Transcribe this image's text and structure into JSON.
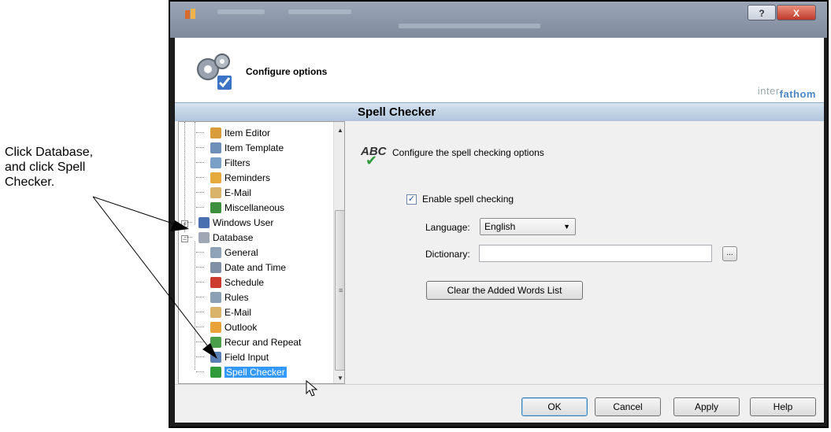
{
  "annotation": {
    "lines": [
      "Click Database,",
      "and click Spell",
      "Checker."
    ]
  },
  "window": {
    "help_button": "?",
    "close_button": "X"
  },
  "header": {
    "title": "Configure options",
    "brand_prefix": "inter",
    "brand_suffix": "fathom"
  },
  "section": {
    "title": "Spell Checker"
  },
  "tree": {
    "items": [
      {
        "label": "Item Editor",
        "icon": "item-editor-icon",
        "color": "#d89c3a"
      },
      {
        "label": "Item Template",
        "icon": "item-template-icon",
        "color": "#6e8fb8"
      },
      {
        "label": "Filters",
        "icon": "filters-icon",
        "color": "#7aa0c8"
      },
      {
        "label": "Reminders",
        "icon": "reminders-icon",
        "color": "#e6a93b"
      },
      {
        "label": "E-Mail",
        "icon": "email-icon",
        "color": "#d9b36a"
      },
      {
        "label": "Miscellaneous",
        "icon": "miscellaneous-icon",
        "color": "#3c8f3c"
      },
      {
        "label": "Windows User",
        "icon": "windows-user-icon",
        "color": "#4a6fb0"
      },
      {
        "label": "Database",
        "icon": "database-icon",
        "color": "#9ea7b3"
      },
      {
        "label": "General",
        "icon": "general-icon",
        "color": "#8ea2b8"
      },
      {
        "label": "Date and Time",
        "icon": "date-time-icon",
        "color": "#7f8fa6"
      },
      {
        "label": "Schedule",
        "icon": "schedule-icon",
        "color": "#cc3b2e"
      },
      {
        "label": "Rules",
        "icon": "rules-icon",
        "color": "#8aa0b5"
      },
      {
        "label": "E-Mail",
        "icon": "email-icon",
        "color": "#d9b36a"
      },
      {
        "label": "Outlook",
        "icon": "outlook-icon",
        "color": "#e8a23a"
      },
      {
        "label": "Recur and Repeat",
        "icon": "recur-repeat-icon",
        "color": "#4aa04a"
      },
      {
        "label": "Field Input",
        "icon": "field-input-icon",
        "color": "#5a7fb5"
      },
      {
        "label": "Spell Checker",
        "icon": "spell-checker-icon",
        "color": "#2f9a3a"
      }
    ],
    "selected": "Spell Checker"
  },
  "spell": {
    "icon_text": "ABC",
    "description": "Configure the spell checking options",
    "enable_label": "Enable spell checking",
    "enable_checked": true,
    "language_label": "Language:",
    "language_value": "English",
    "dictionary_label": "Dictionary:",
    "dictionary_value": "",
    "browse_label": "...",
    "clear_button": "Clear the Added Words List"
  },
  "footer": {
    "ok": "OK",
    "cancel": "Cancel",
    "apply": "Apply",
    "help": "Help"
  }
}
